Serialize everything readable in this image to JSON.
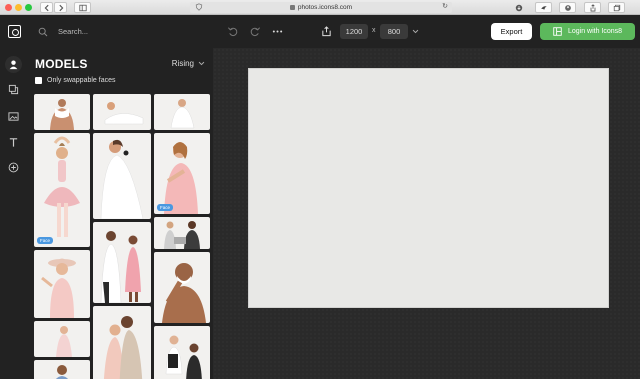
{
  "browser": {
    "url": "photos.icons8.com",
    "reload_icon": "reload-icon"
  },
  "header": {
    "search_placeholder": "Search...",
    "width": "1200",
    "times": "x",
    "height": "800",
    "export_label": "Export",
    "login_label": "Login with Icons8"
  },
  "rail": {
    "items": [
      "person-icon",
      "layers-icon",
      "image-icon",
      "text-icon",
      "add-icon"
    ]
  },
  "models": {
    "title": "MODELS",
    "sort_label": "Rising",
    "checkbox_label": "Only swappable faces",
    "face_badge": "Face",
    "tiles": [
      {
        "name": "model-man-towel"
      },
      {
        "name": "model-woman-lying"
      },
      {
        "name": "model-woman-white-sitting"
      },
      {
        "name": "model-girl-ballerina",
        "badge": true
      },
      {
        "name": "model-woman-white-dress"
      },
      {
        "name": "model-girl-pink",
        "badge": true
      },
      {
        "name": "model-man-laptop"
      },
      {
        "name": "model-couple-dance"
      },
      {
        "name": "model-man-shaving"
      },
      {
        "name": "model-girl-hat"
      },
      {
        "name": "model-couple-hug"
      },
      {
        "name": "model-woman-sitting-pink"
      },
      {
        "name": "model-chef-duo"
      }
    ]
  },
  "colors": {
    "accent_green": "#5cb85c",
    "badge_blue": "#4a98e0",
    "panel_bg": "#222222",
    "workspace_bg": "#2a2a2a",
    "canvas_bg": "#e8e8e6"
  }
}
